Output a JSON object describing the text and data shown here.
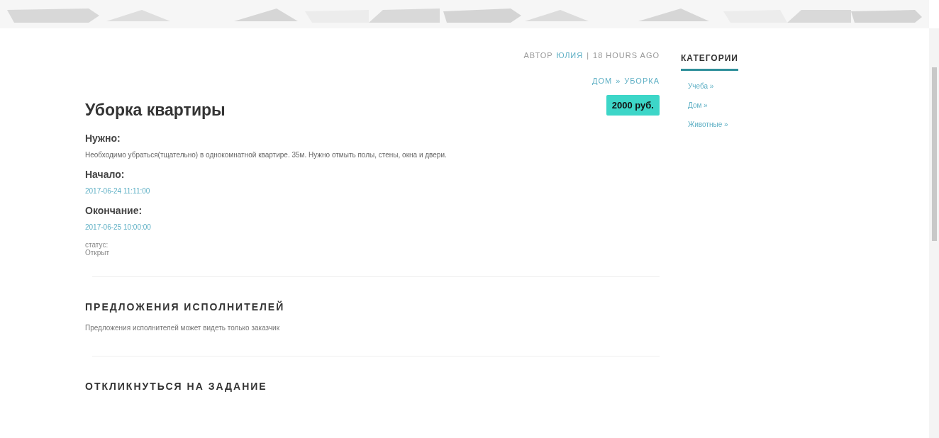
{
  "meta": {
    "author_prefix": "АВТОР",
    "author": "ЮЛИЯ",
    "separator": "|",
    "time": "18 HOURS AGO"
  },
  "breadcrumb": [
    {
      "label": "ДОМ"
    },
    {
      "label": "»"
    },
    {
      "label": "УБОРКА"
    }
  ],
  "price": "2000 руб.",
  "title": "Уборка квартиры",
  "fields": [
    {
      "label": "Нужно:",
      "value": "Необходимо убраться(тщательно) в однокомнатной квартире. 35м. Нужно отмыть полы, стены, окна и двери.",
      "kind": "text"
    },
    {
      "label": "Начало:",
      "value": "2017-06-24 11:11:00",
      "kind": "date"
    },
    {
      "label": "Окончание:",
      "value": "2017-06-25 10:00:00",
      "kind": "date"
    }
  ],
  "status": {
    "label": "статус:",
    "value": "Открыт"
  },
  "sections": [
    {
      "heading": "ПРЕДЛОЖЕНИЯ ИСПОЛНИТЕЛЕЙ",
      "text": "Предложения исполнителей может видеть только заказчик"
    },
    {
      "heading": "ОТКЛИКНУТЬСЯ НА ЗАДАНИЕ"
    }
  ],
  "sidebar": {
    "title": "КАТЕГОРИИ",
    "items": [
      {
        "label": "Учеба »"
      },
      {
        "label": "Дом »"
      },
      {
        "label": "Животные »"
      }
    ]
  }
}
